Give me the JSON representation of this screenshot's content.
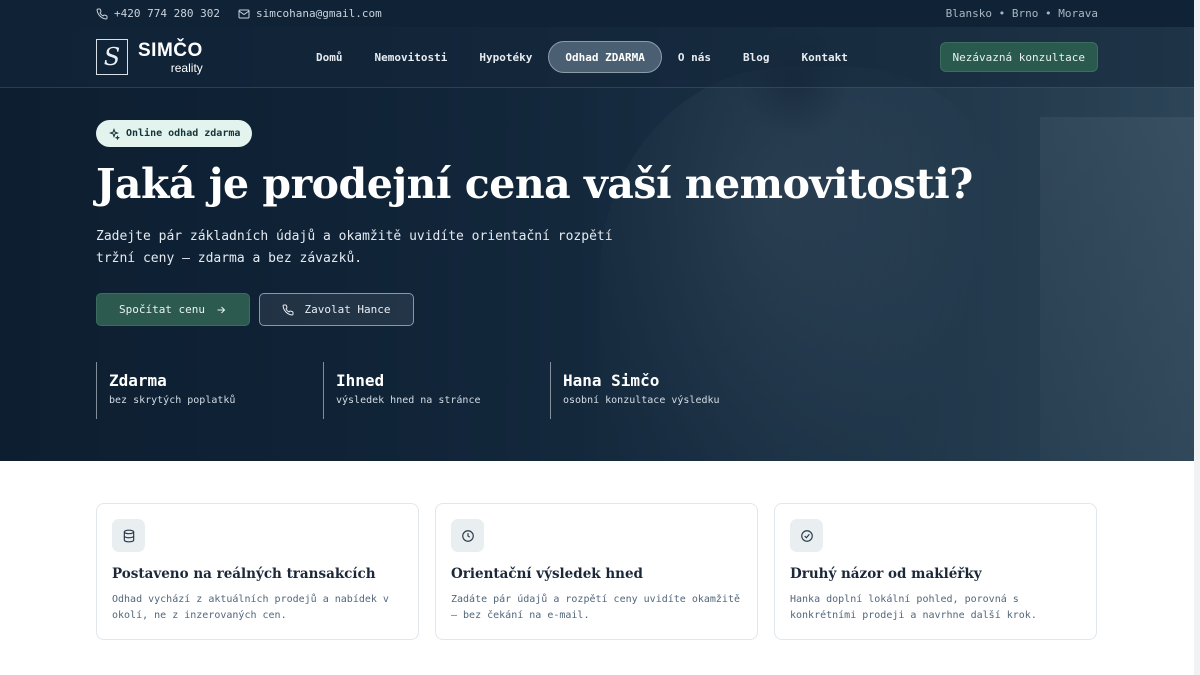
{
  "topbar": {
    "phone": "+420 774 280 302",
    "email": "simcohana@gmail.com",
    "locations": "Blansko • Brno • Morava"
  },
  "logo": {
    "mark": "S",
    "name": "SIMČO",
    "sub": "reality"
  },
  "nav": {
    "items": [
      {
        "label": "Domů"
      },
      {
        "label": "Nemovitosti"
      },
      {
        "label": "Hypotéky"
      },
      {
        "label": "Odhad ZDARMA",
        "active": true
      },
      {
        "label": "O nás"
      },
      {
        "label": "Blog"
      },
      {
        "label": "Kontakt"
      }
    ],
    "cta": "Nezávazná konzultace"
  },
  "hero": {
    "badge": "Online odhad zdarma",
    "title": "Jaká je prodejní cena vaší nemovitosti?",
    "subtitle": "Zadejte pár základních údajů a okamžitě uvidíte orientační rozpětí tržní ceny – zdarma a bez závazků.",
    "primary_button": "Spočítat cenu",
    "secondary_button": "Zavolat Hance",
    "stats": [
      {
        "title": "Zdarma",
        "desc": "bez skrytých poplatků"
      },
      {
        "title": "Ihned",
        "desc": "výsledek hned na stránce"
      },
      {
        "title": "Hana Simčo",
        "desc": "osobní konzultace výsledku"
      }
    ]
  },
  "cards": [
    {
      "icon": "database-icon",
      "title": "Postaveno na reálných transakcích",
      "text": "Odhad vychází z aktuálních prodejů a nabídek v okolí, ne z inzerovaných cen."
    },
    {
      "icon": "clock-icon",
      "title": "Orientační výsledek hned",
      "text": "Zadáte pár údajů a rozpětí ceny uvidíte okamžitě – bez čekání na e-mail."
    },
    {
      "icon": "check-circle-icon",
      "title": "Druhý názor od makléřky",
      "text": "Hanka doplní lokální pohled, porovná s konkrétními prodeji a navrhne další krok."
    }
  ],
  "colors": {
    "navy": "#102235",
    "accent_green": "#2c5a4e",
    "badge_bg": "#e3f4ee"
  }
}
